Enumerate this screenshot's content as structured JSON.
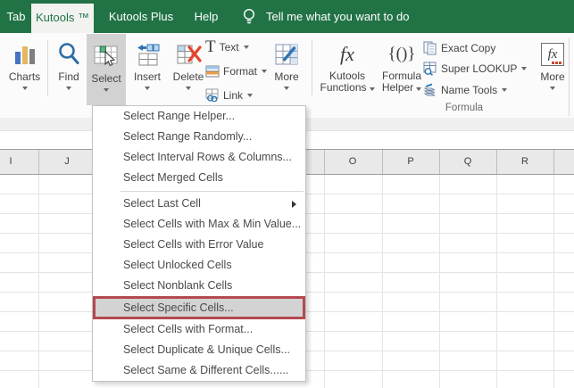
{
  "titlebar": {
    "bg_color": "#217346",
    "tabs": [
      {
        "label": "Tab",
        "active": false
      },
      {
        "label": "Kutools ™",
        "active": true
      },
      {
        "label": "Kutools Plus",
        "active": false
      },
      {
        "label": "Help",
        "active": false
      }
    ],
    "tell_me": "Tell me what you want to do"
  },
  "ribbon": {
    "charts": "Charts",
    "find": "Find",
    "select": "Select",
    "insert": "Insert",
    "delete": "Delete",
    "text": "Text",
    "format": "Format",
    "link": "Link",
    "more_tools": "More",
    "kutools_functions_line1": "Kutools",
    "kutools_functions_line2": "Functions",
    "formula_helper_line1": "Formula",
    "formula_helper_line2": "Helper",
    "exact_copy": "Exact Copy",
    "super_lookup": "Super LOOKUP",
    "name_tools": "Name Tools",
    "group_formula": "Formula",
    "more_formula": "More",
    "glyphs": {
      "fx": "fx",
      "braces": "{()}",
      "text_t": "T"
    }
  },
  "menu": {
    "items": [
      {
        "label": "Select Range Helper..."
      },
      {
        "label": "Select Range Randomly..."
      },
      {
        "label": "Select Interval Rows & Columns..."
      },
      {
        "label": "Select Merged Cells"
      },
      {
        "label": "Select Last Cell",
        "submenu": true
      },
      {
        "label": "Select Cells with Max & Min Value..."
      },
      {
        "label": "Select Cells with Error Value"
      },
      {
        "label": "Select Unlocked Cells"
      },
      {
        "label": "Select Nonblank Cells"
      },
      {
        "label": "Select Specific Cells...",
        "highlighted": true
      },
      {
        "label": "Select Cells with Format..."
      },
      {
        "label": "Select Duplicate & Unique Cells..."
      },
      {
        "label": "Select Same & Different Cells......"
      }
    ],
    "highlight_bg": "#d3d3d3",
    "highlight_border": "#b5494f"
  },
  "spreadsheet": {
    "columns": [
      "I",
      "J",
      "O",
      "P",
      "Q",
      "R"
    ]
  }
}
